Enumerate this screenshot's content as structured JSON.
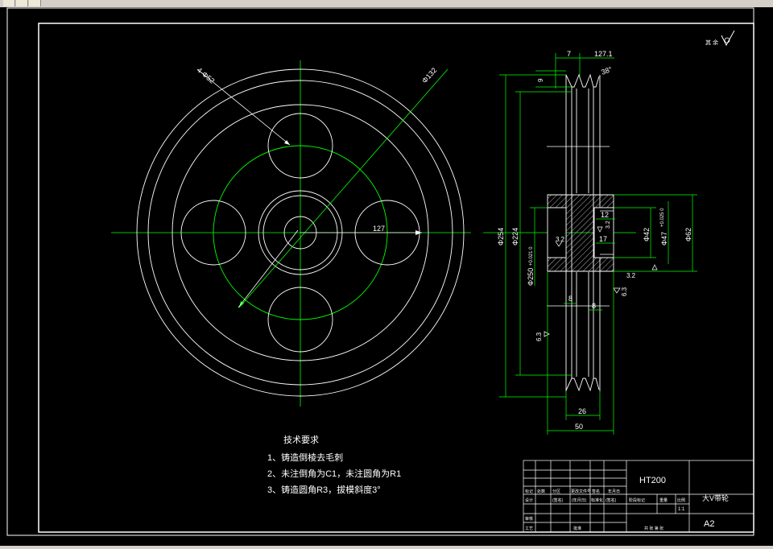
{
  "toolbar": {
    "buttons": [
      "toolbar-button-1",
      "toolbar-button-2",
      "toolbar-button-3"
    ]
  },
  "colors": {
    "background": "#000000",
    "outline": "#ffffff",
    "dimension": "#00ff00",
    "centerline": "#00ff00"
  },
  "drawing": {
    "roughness_symbol": "其 余",
    "front_dims": {
      "hole_dia": "4-Φ52",
      "pitch_dia": "Φ132",
      "radius": "127"
    },
    "section_dims": {
      "top_w": "7",
      "top_len": "127.1",
      "angle": "38°",
      "top_h": "9",
      "d254": "Φ254",
      "d224": "Φ224",
      "d250": "Φ250",
      "d250_tol": "+0.021\n0",
      "d42": "Φ42",
      "d47": "Φ47",
      "d47_tol": "+0.025\n0",
      "d62": "Φ62",
      "w12": "12",
      "w17": "17",
      "w8a": "8",
      "w8b": "8",
      "w26": "26",
      "w50": "50",
      "r32a": "3.2",
      "r32b": "3.2",
      "r32c": "3.2",
      "r63a": "6.3",
      "r63b": "6.3",
      "r32d": "3.2"
    },
    "tech_requirements": {
      "title": "技术要求",
      "items": [
        "1、铸造倒棱去毛刺",
        "2、未注倒角为C1，未注圆角为R1",
        "3、铸造圆角R3，拔模斜度3°"
      ]
    },
    "title_block": {
      "material": "HT200",
      "part_name": "大V带轮",
      "sheet_size": "A2",
      "scale": "1:1",
      "header_cells": [
        "标记",
        "处数",
        "分区",
        "更改文件号",
        "签名",
        "年月日"
      ],
      "row2": [
        "设计",
        "",
        "(签名)",
        "(年月日)",
        "标准化",
        "(签名)",
        "(年月日)"
      ],
      "row3": [
        "审核",
        "工艺",
        "批准"
      ],
      "right_cells": [
        "阶段标记",
        "重量",
        "比例"
      ],
      "sheet_info": "共 张 第 张"
    }
  }
}
